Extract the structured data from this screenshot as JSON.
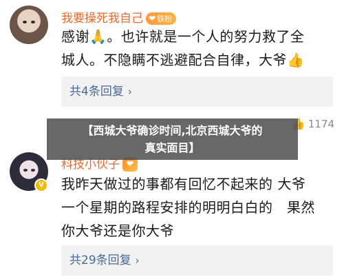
{
  "comments": [
    {
      "username": "我要操死我自己",
      "fan_badge": "铁粉",
      "content_line1": "感谢🙏。也许就是一个人的努力救了全",
      "content_line2": "城人。不隐瞒不逃避配合自律，大爷👍",
      "replies": "共4条回复",
      "likes": "1174"
    },
    {
      "username": "科技小伙子",
      "vip_badge": "V",
      "content_line1": "我昨天做过的事都有回忆不起来的 大爷",
      "content_line2": "一个星期的路程安排的明明白白的　果然",
      "content_line3": "你大爷还是你大爷",
      "replies": "共29条回复"
    }
  ],
  "overlay": {
    "title_line1": "【西城大爷确诊时间,北京西城大爷的",
    "title_line2": "真实面目】"
  },
  "icons": {
    "chevron": "›",
    "thumb": "👍",
    "heart": "❤"
  }
}
